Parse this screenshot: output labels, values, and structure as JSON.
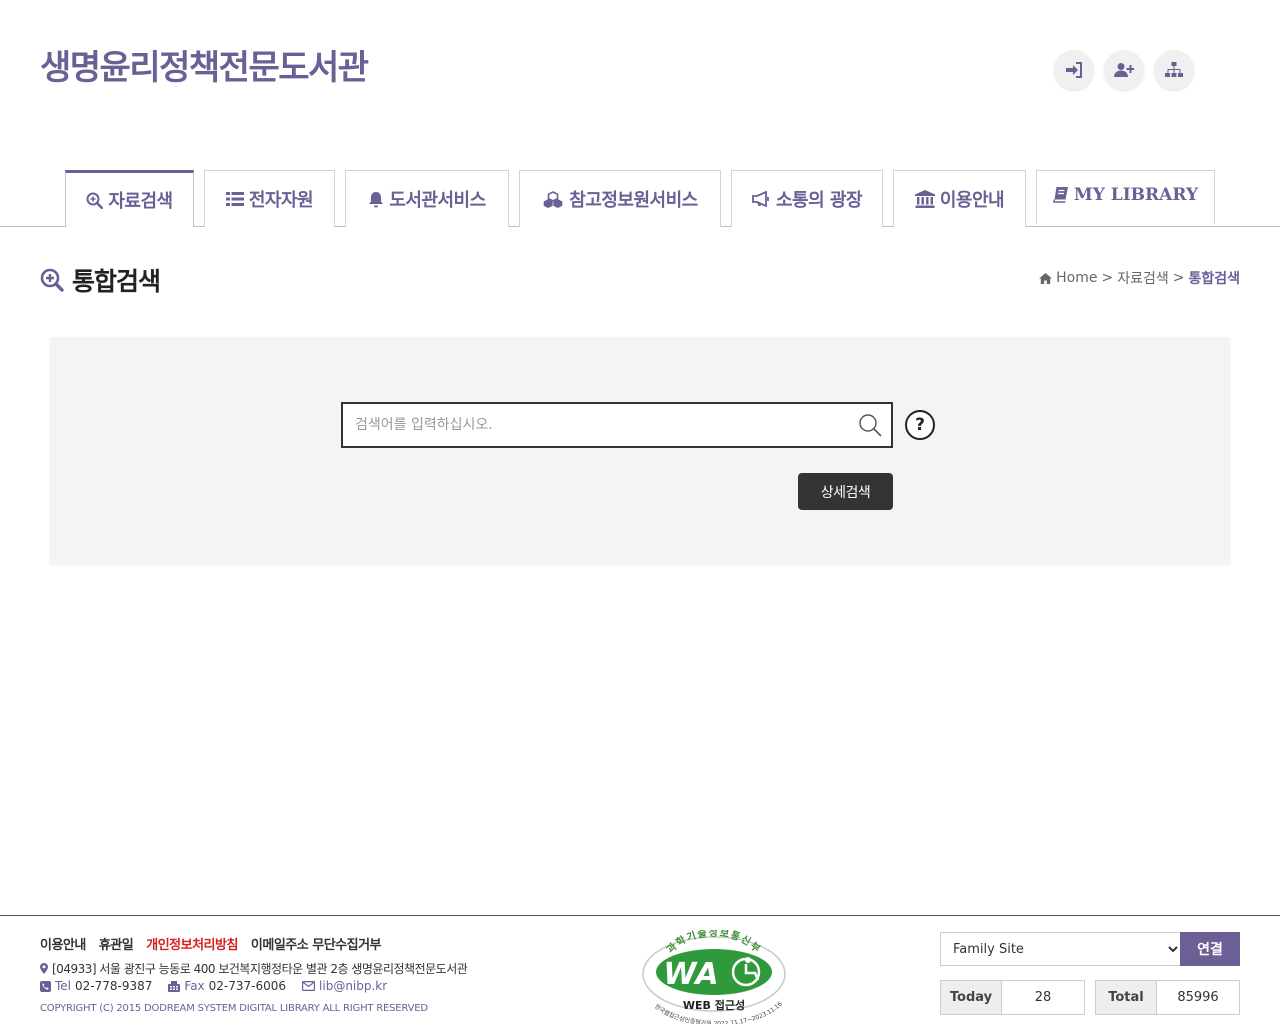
{
  "site": {
    "title": "생명윤리정책전문도서관"
  },
  "top_icons": [
    {
      "name": "login-icon"
    },
    {
      "name": "add-user-icon"
    },
    {
      "name": "sitemap-icon"
    }
  ],
  "nav": {
    "tabs": [
      {
        "label": "자료검색",
        "icon": "search-plus-icon",
        "active": true
      },
      {
        "label": "전자자원",
        "icon": "list-icon"
      },
      {
        "label": "도서관서비스",
        "icon": "bell-icon"
      },
      {
        "label": "참고정보원서비스",
        "icon": "cubes-icon"
      },
      {
        "label": "소통의 광장",
        "icon": "megaphone-icon"
      },
      {
        "label": "이용안내",
        "icon": "institution-icon"
      },
      {
        "label": "MY LIBRARY",
        "icon": "book-icon"
      }
    ]
  },
  "page": {
    "title": "통합검색",
    "breadcrumb": {
      "home": "Home",
      "sep": ">",
      "section": "자료검색",
      "current": "통합검색"
    }
  },
  "search": {
    "placeholder": "검색어를 입력하십시오.",
    "value": "",
    "help_label": "?",
    "advanced_label": "상세검색"
  },
  "footer": {
    "links": [
      {
        "label": "이용안내"
      },
      {
        "label": "휴관일"
      },
      {
        "label": "개인정보처리방침",
        "highlight": true
      },
      {
        "label": "이메일주소 무단수집거부"
      }
    ],
    "address": "[04933] 서울 광진구 능동로 400 보건복지행정타운 별관 2층 생명윤리정책전문도서관",
    "tel_label": "Tel",
    "tel": "02-778-9387",
    "fax_label": "Fax",
    "fax": "02-737-6006",
    "email": "lib@nibp.kr",
    "copyright": "COPYRIGHT (C) 2015 DODREAM SYSTEM DIGITAL LIBRARY ALL RIGHT RESERVED",
    "wa_mark": {
      "top_text": "과학기술정보통신부",
      "logo_text": "WA",
      "bottom_text": "WEB 접근성",
      "cert_text": "한국웹접근성인증평가원 2022.11.17~2023.11.16"
    },
    "family_site": {
      "selected": "Family Site",
      "button": "연결"
    },
    "counter": {
      "today_label": "Today",
      "today": "28",
      "total_label": "Total",
      "total": "85996"
    }
  },
  "colors": {
    "brand": "#6b5f96",
    "privacy_link": "#d6211d",
    "panel_bg": "#f4f4f4",
    "button_dark": "#333333"
  }
}
